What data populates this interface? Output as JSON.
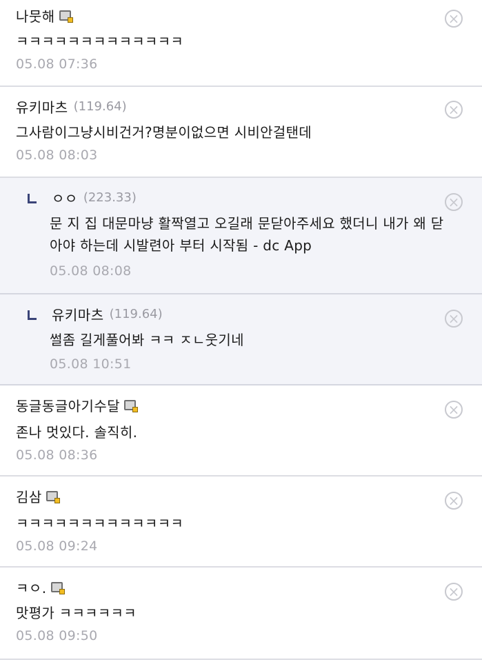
{
  "comments": [
    {
      "nick": "나뭇해",
      "ip": "",
      "gallog": true,
      "text": "ㅋㅋㅋㅋㅋㅋㅋㅋㅋㅋㅋㅋㅋ",
      "date": "05.08 07:36",
      "is_reply": false
    },
    {
      "nick": "유키마츠",
      "ip": "(119.64)",
      "gallog": false,
      "text": "그사람이그냥시비건거?명분이없으면 시비안걸탠데",
      "date": "05.08 08:03",
      "is_reply": false
    },
    {
      "nick": "ㅇㅇ",
      "ip": "(223.33)",
      "gallog": false,
      "text": "문 지 집 대문마냥 활짝열고 오길래 문닫아주세요 했더니 내가 왜 닫아야 하는데 시발련아 부터 시작됨 - dc App",
      "date": "05.08 08:08",
      "is_reply": true
    },
    {
      "nick": "유키마츠",
      "ip": "(119.64)",
      "gallog": false,
      "text": "썰좀 길게풀어봐 ㅋㅋ ㅈㄴ웃기네",
      "date": "05.08 10:51",
      "is_reply": true
    },
    {
      "nick": "동글동글아기수달",
      "ip": "",
      "gallog": true,
      "text": "존나 멋있다. 솔직히.",
      "date": "05.08 08:36",
      "is_reply": false
    },
    {
      "nick": "김삼",
      "ip": "",
      "gallog": true,
      "text": "ㅋㅋㅋㅋㅋㅋㅋㅋㅋㅋㅋㅋㅋ",
      "date": "05.08 09:24",
      "is_reply": false
    },
    {
      "nick": "ㅋㅇ.",
      "ip": "",
      "gallog": true,
      "text": "맛평가 ㅋㅋㅋㅋㅋㅋ",
      "date": "05.08 09:50",
      "is_reply": false
    }
  ],
  "icons": {
    "delete": "circle-x-icon",
    "gallog": "gallog-icon",
    "reply": "reply-arrow-icon"
  },
  "colors": {
    "reply_background": "#f3f4f9",
    "reply_mark": "#3a4478",
    "meta_text": "#a9a9b0"
  }
}
